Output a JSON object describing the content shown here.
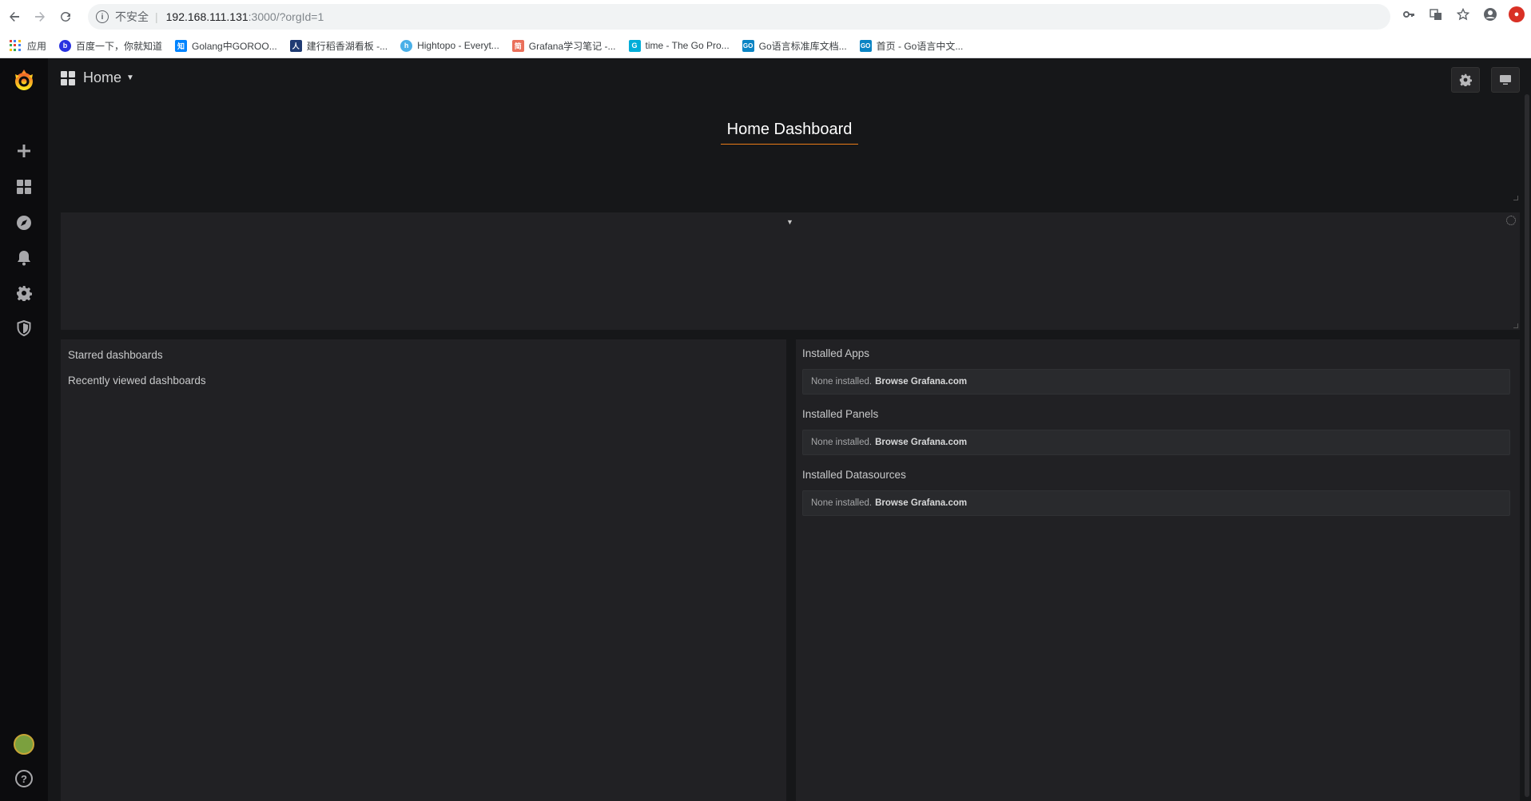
{
  "browser": {
    "insecure_label": "不安全",
    "url_host": "192.168.111.131",
    "url_path": ":3000/?orgId=1",
    "bookmarks": [
      {
        "label": "应用",
        "icon": "apps-grid-icon",
        "color": "#4285f4"
      },
      {
        "label": "百度一下，你就知道",
        "icon": "baidu-icon",
        "color": "#2932e1"
      },
      {
        "label": "Golang中GOROO...",
        "icon": "zhihu-icon",
        "color": "#0084ff"
      },
      {
        "label": "建行稻香湖看板 -...",
        "icon": "people-icon",
        "color": "#1f3b73"
      },
      {
        "label": "Hightopo - Everyt...",
        "icon": "hightopo-icon",
        "color": "#4ab0e8"
      },
      {
        "label": "Grafana学习笔记 -...",
        "icon": "jianshu-icon",
        "color": "#ea6f5a"
      },
      {
        "label": "time - The Go Pro...",
        "icon": "gopher-icon",
        "color": "#00add8"
      },
      {
        "label": "Go语言标准库文档...",
        "icon": "go-icon",
        "color": "#0a84c4"
      },
      {
        "label": "首页 - Go语言中文...",
        "icon": "go-icon",
        "color": "#0a84c4"
      }
    ]
  },
  "topbar": {
    "dashboard_name": "Home"
  },
  "dashboard": {
    "title": "Home Dashboard",
    "left_panel": {
      "starred": "Starred dashboards",
      "recent": "Recently viewed dashboards"
    },
    "right_panel": {
      "sections": [
        {
          "heading": "Installed Apps",
          "text": "None installed.",
          "link": "Browse Grafana.com"
        },
        {
          "heading": "Installed Panels",
          "text": "None installed.",
          "link": "Browse Grafana.com"
        },
        {
          "heading": "Installed Datasources",
          "text": "None installed.",
          "link": "Browse Grafana.com"
        }
      ]
    }
  },
  "colors": {
    "accent": "#eb7b18",
    "background": "#161719",
    "panel": "#212124"
  }
}
